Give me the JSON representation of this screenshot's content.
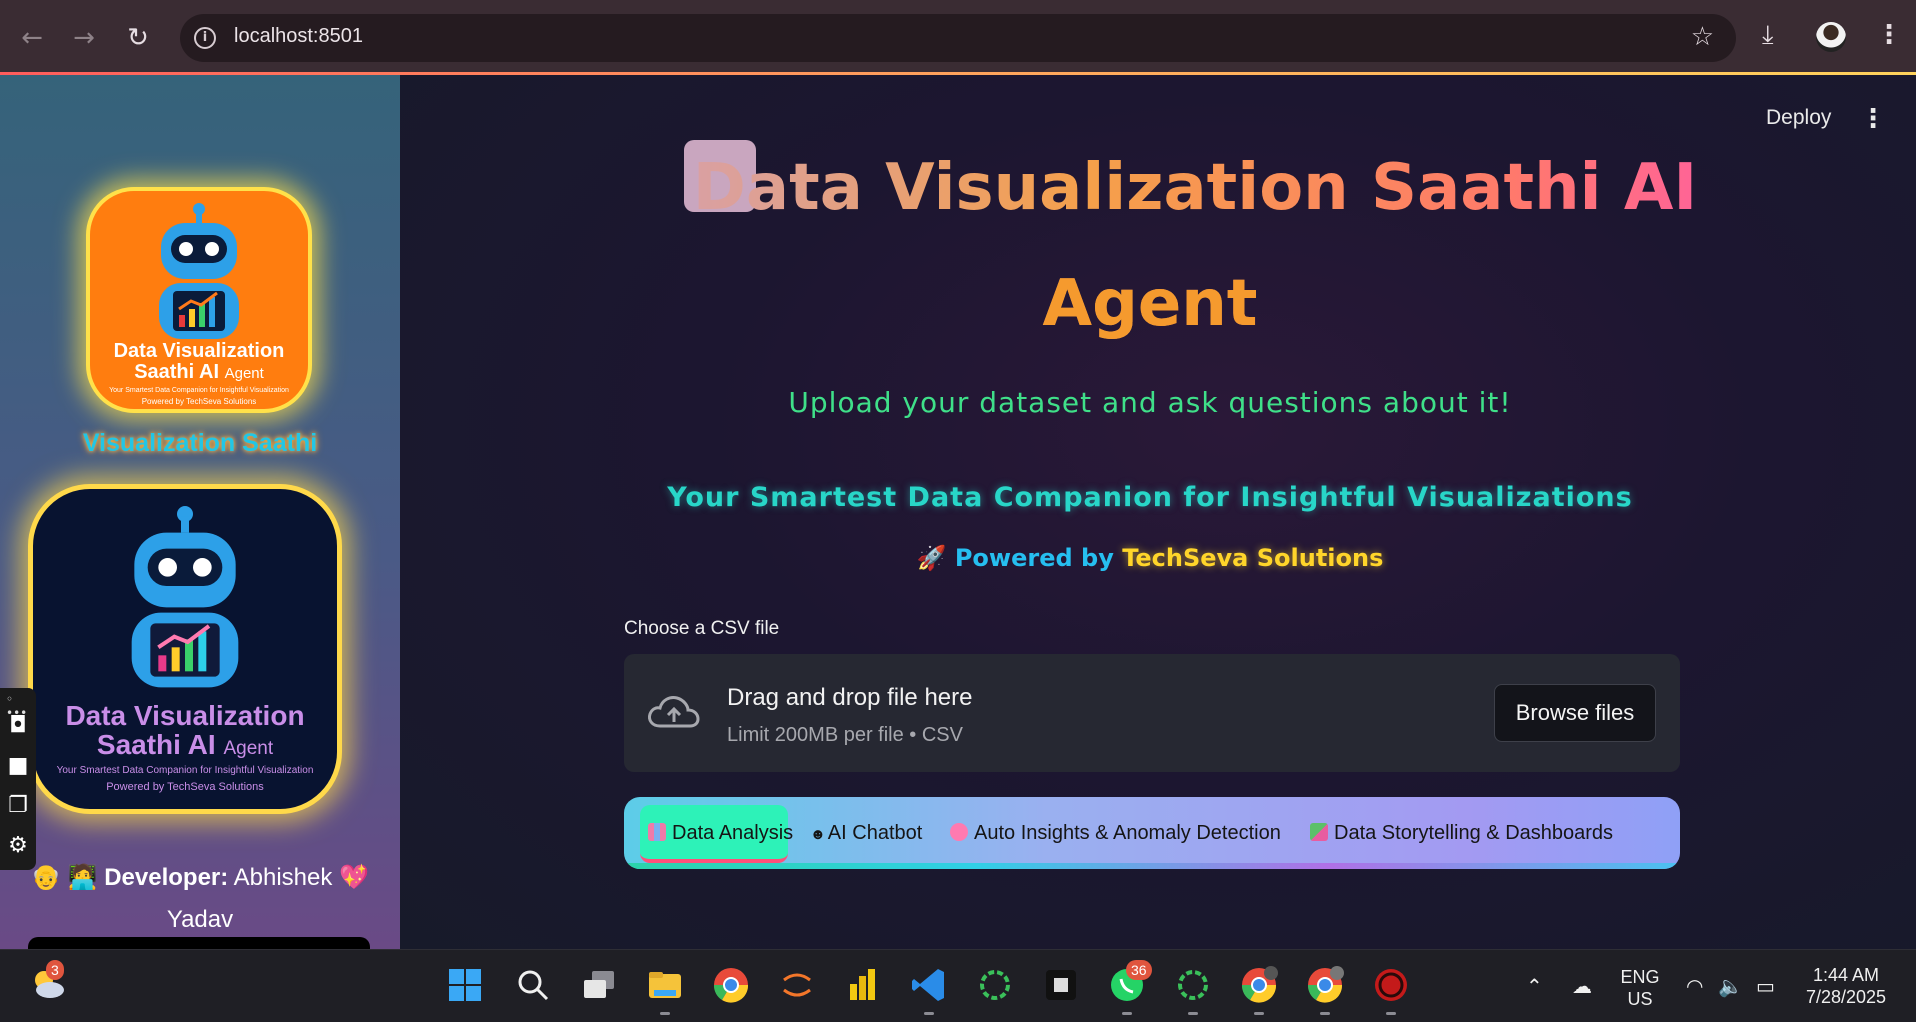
{
  "browser": {
    "url": "localhost:8501",
    "back_icon": "back-arrow-icon",
    "forward_icon": "forward-arrow-icon",
    "reload_icon": "reload-icon"
  },
  "app": {
    "deploy_label": "Deploy",
    "title_line1": "Data Visualization Saathi AI",
    "title_line2": "Agent",
    "subtitle": "Upload your dataset and ask questions about it!",
    "tagline": "Your Smartest Data Companion for Insightful Visualizations",
    "powered_prefix": "🚀 Powered by",
    "powered_brand": "TechSeva Solutions",
    "uploader": {
      "label": "Choose a CSV file",
      "drop_text": "Drag and drop file here",
      "limit_text": "Limit 200MB per file • CSV",
      "browse_label": "Browse files"
    },
    "tabs": [
      {
        "label": "Data Analysis",
        "icon_color": "#ef7aa8"
      },
      {
        "label": "AI Chatbot",
        "icon_color": "#444"
      },
      {
        "label": "Auto Insights & Anomaly Detection",
        "icon_color": "#ff7ab0"
      },
      {
        "label": "Data Storytelling & Dashboards",
        "icon_color": "#5cc06a"
      }
    ]
  },
  "sidebar": {
    "logo_small": {
      "title_line1": "Data Visualization",
      "title_line2": "Saathi AI",
      "title_suffix": "Agent",
      "tagline": "Your Smartest Data Companion for Insightful Visualization",
      "powered": "Powered by TechSeva Solutions"
    },
    "name": "Visualization Saathi",
    "logo_large": {
      "title_line1": "Data Visualization",
      "title_line2": "Saathi AI",
      "title_suffix": "Agent",
      "tagline": "Your Smartest Data Companion for Insightful Visualization",
      "powered": "Powered by TechSeva Solutions"
    },
    "developer_prefix": "👴 🧑‍💻",
    "developer_label": "Developer:",
    "developer_name": "Abhishek 💖 Yadav"
  },
  "taskbar": {
    "weather_badge": "3",
    "whatsapp_badge": "36",
    "lang_line1": "ENG",
    "lang_line2": "US",
    "time": "1:44 AM",
    "date": "7/28/2025"
  },
  "colors": {
    "accent_orange": "#f59a2e",
    "accent_green": "#3fe089",
    "accent_teal": "#28d6c8",
    "brand_yellow": "#ffd52a"
  }
}
